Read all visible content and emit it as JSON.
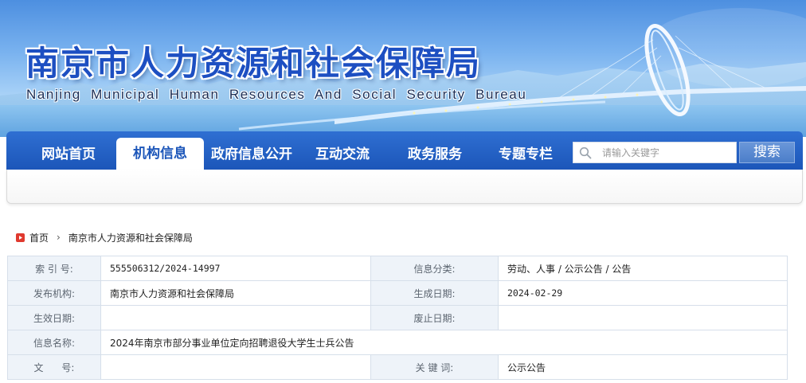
{
  "header": {
    "title_cn": "南京市人力资源和社会保障局",
    "title_en": "Nanjing Municipal Human Resources And Social Security Bureau"
  },
  "nav": {
    "items": [
      {
        "label": "网站首页",
        "active": false
      },
      {
        "label": "机构信息",
        "active": true
      },
      {
        "label": "政府信息公开",
        "active": false
      },
      {
        "label": "互动交流",
        "active": false
      },
      {
        "label": "政务服务",
        "active": false
      },
      {
        "label": "专题专栏",
        "active": false
      }
    ],
    "search": {
      "placeholder": "请输入关键字",
      "button_label": "搜索"
    }
  },
  "breadcrumb": {
    "items": [
      "首页",
      "南京市人力资源和社会保障局"
    ]
  },
  "info": {
    "index_label": "索 引 号:",
    "index_value": "555506312/2024-14997",
    "category_label": "信息分类:",
    "category_value": "劳动、人事 / 公示公告 / 公告",
    "publisher_label": "发布机构:",
    "publisher_value": "南京市人力资源和社会保障局",
    "created_label": "生成日期:",
    "created_value": "2024-02-29",
    "effective_label": "生效日期:",
    "effective_value": "",
    "repeal_label": "废止日期:",
    "repeal_value": "",
    "name_label": "信息名称:",
    "name_value": "2024年南京市部分事业单位定向招聘退役大学生士兵公告",
    "docno_label": "文      号:",
    "docno_value": "",
    "keywords_label": "关 键 词:",
    "keywords_value": "公示公告"
  },
  "colors": {
    "brand_blue": "#1c56b9",
    "title_blue": "#1d4fc2",
    "label_bg": "#eef3f9",
    "home_icon_red": "#e03a2f"
  }
}
